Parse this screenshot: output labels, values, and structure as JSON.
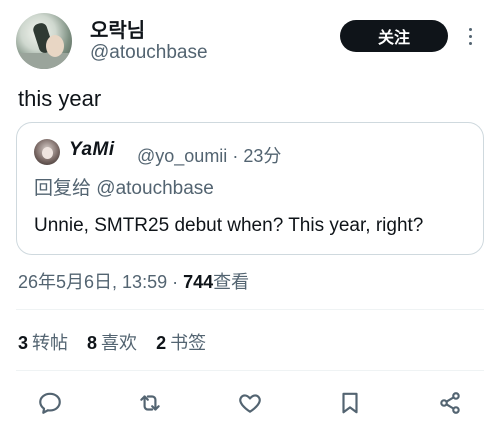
{
  "author": {
    "display_name": "오락님",
    "handle": "@atouchbase",
    "avatar_icon": "profile-photo"
  },
  "buttons": {
    "follow_label": "关注",
    "more_icon": "more-vertical-icon"
  },
  "tweet": {
    "text": "this year"
  },
  "quoted": {
    "display_name": "YaMi",
    "handle": "@yo_oumii",
    "separator": "·",
    "time": "23分",
    "reply_prefix": "回复给",
    "reply_to": "@atouchbase",
    "text": "Unnie, SMTR25 debut when? This year, right?"
  },
  "meta": {
    "datetime": "26年5月6日, 13:59",
    "separator": "·",
    "views_count": "744",
    "views_label": "查看"
  },
  "stats": {
    "retweets_count": "3",
    "retweets_label": "转帖",
    "likes_count": "8",
    "likes_label": "喜欢",
    "bookmarks_count": "2",
    "bookmarks_label": "书签"
  },
  "actions": [
    "reply-icon",
    "retweet-icon",
    "like-icon",
    "bookmark-icon",
    "share-icon"
  ],
  "colors": {
    "text_primary": "#0f1419",
    "text_secondary": "#536471",
    "border": "#cfd9de",
    "button_bg": "#0f1419",
    "button_text": "#ffffff"
  }
}
